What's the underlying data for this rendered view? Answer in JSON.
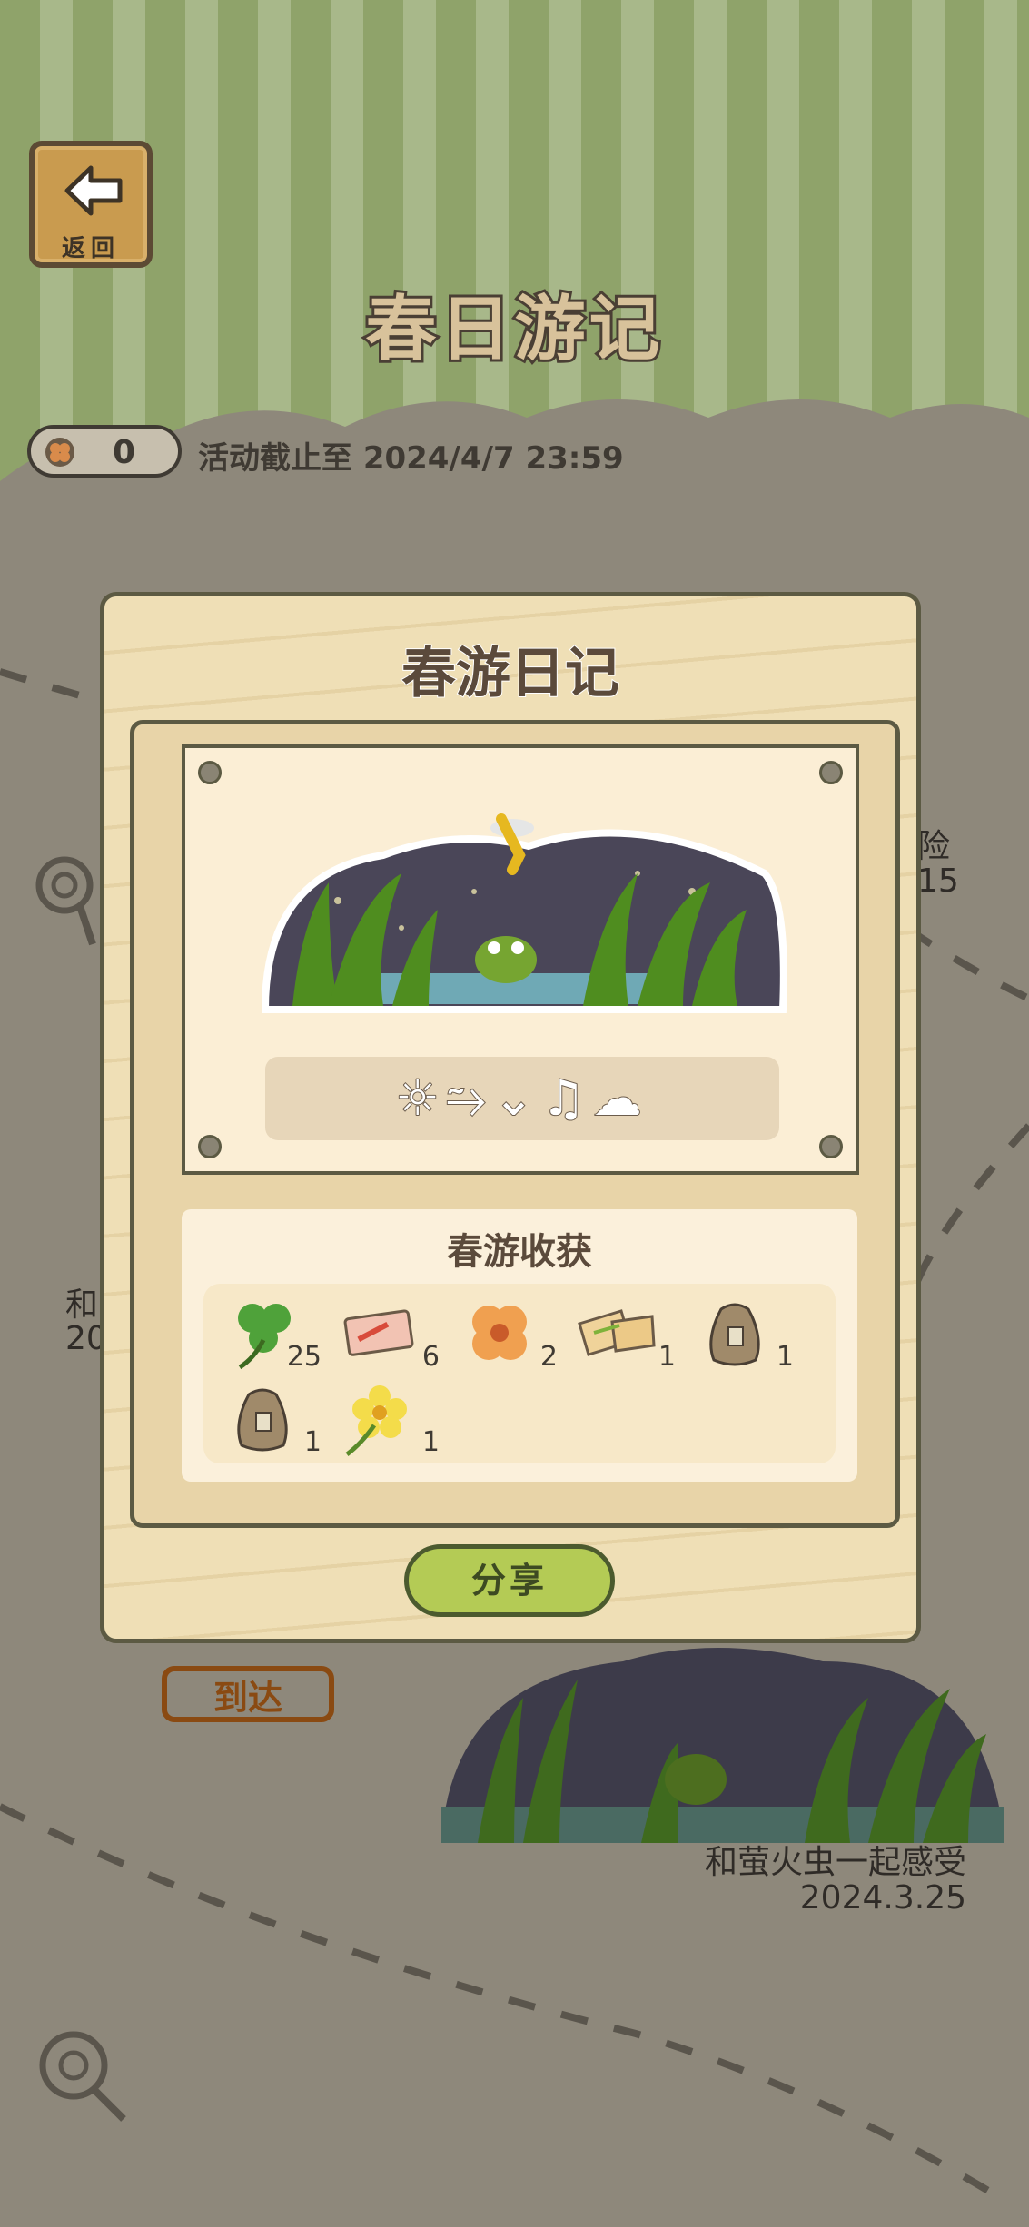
{
  "header": {
    "back_label": "返回",
    "title": "春日游记",
    "clover_count": "0",
    "deadline": "活动截止至 2024/4/7 23:59"
  },
  "map": {
    "partial_label_right_1": "险",
    "partial_label_right_2": "15",
    "partial_label_left_1": "和",
    "partial_label_left_2": "20",
    "arrive_tag": "到达",
    "entry_caption": "和萤火虫一起感受",
    "entry_date": "2024.3.25"
  },
  "modal": {
    "title": "春游日记",
    "emoji_text": "☼⥲⌄♫☁",
    "harvest_title": "春游收获",
    "items": [
      {
        "icon": "clover-icon",
        "count": "25"
      },
      {
        "icon": "ticket-icon",
        "count": "6"
      },
      {
        "icon": "flower-charm-icon",
        "count": "2"
      },
      {
        "icon": "sandwich-icon",
        "count": "1"
      },
      {
        "icon": "seed-bag-icon",
        "count": "1"
      },
      {
        "icon": "seed-bag-icon",
        "count": "1"
      },
      {
        "icon": "yellow-flower-icon",
        "count": "1"
      }
    ],
    "share_label": "分享"
  },
  "colors": {
    "accent_green": "#b4cb55",
    "header_green": "#8fa36a",
    "wood": "#efdfb6"
  }
}
